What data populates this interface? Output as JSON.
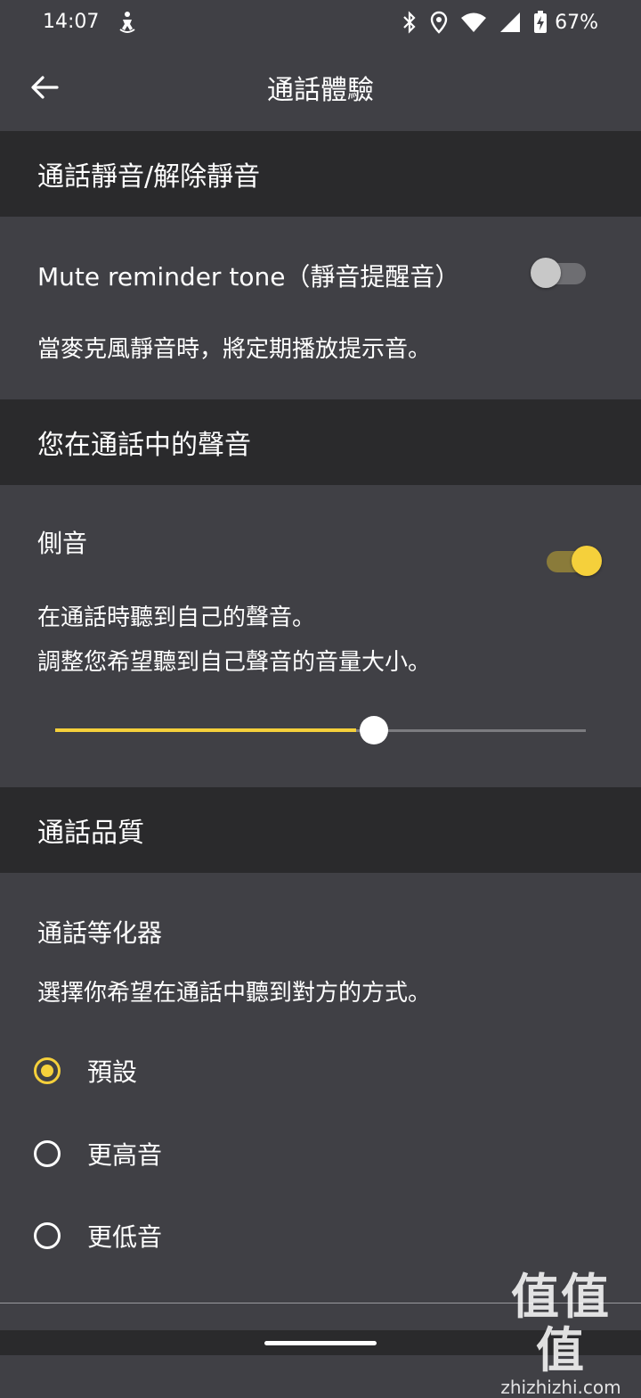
{
  "status_bar": {
    "time": "14:07",
    "battery_percent": "67%",
    "icons": [
      "accessibility-icon",
      "bluetooth-icon",
      "location-icon",
      "wifi-icon",
      "cell-signal-icon",
      "battery-charging-icon"
    ]
  },
  "app_bar": {
    "title": "通話體驗",
    "back_icon": "arrow-left-icon"
  },
  "sections": {
    "mute": {
      "header": "通話靜音/解除靜音",
      "item_title": "Mute reminder tone（靜音提醒音）",
      "item_desc": "當麥克風靜音時，將定期播放提示音。",
      "toggle_on": false
    },
    "voice": {
      "header": "您在通話中的聲音",
      "item_title": "側音",
      "desc_line1": "在通話時聽到自己的聲音。",
      "desc_line2": "調整您希望聽到自己聲音的音量大小。",
      "toggle_on": true,
      "slider_value_fraction": 0.6
    },
    "quality": {
      "header": "通話品質",
      "item_title": "通話等化器",
      "item_desc": "選擇你希望在通話中聽到對方的方式。",
      "options": [
        {
          "label": "預設",
          "selected": true
        },
        {
          "label": "更高音",
          "selected": false
        },
        {
          "label": "更低音",
          "selected": false
        }
      ]
    }
  },
  "watermark": {
    "main": "值值值",
    "sub": "zhizhizhi.com"
  },
  "colors": {
    "accent": "#f5d03b",
    "background": "#404045",
    "section_header": "#2a2a2c",
    "text": "#ffffff"
  }
}
